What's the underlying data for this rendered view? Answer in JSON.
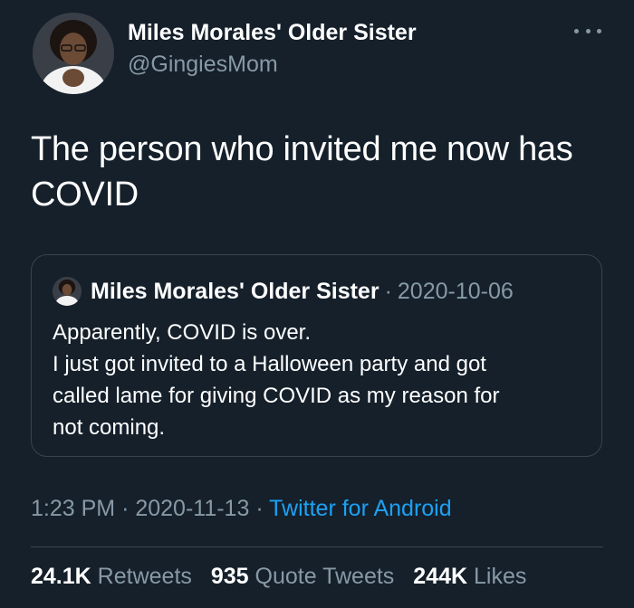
{
  "author": {
    "name": "Miles Morales' Older Sister",
    "handle": "@GingiesMom"
  },
  "tweet": {
    "text_line1": "The person who invited me now has",
    "text_line2": "COVID"
  },
  "quoted_tweet": {
    "name": "Miles Morales' Older Sister",
    "separator": "·",
    "date": "2020-10-06",
    "lines": [
      "Apparently, COVID is over.",
      "I just got invited to a Halloween party and got",
      "called lame for giving COVID as my reason for",
      "not coming."
    ]
  },
  "meta": {
    "time": "1:23 PM",
    "separator": "·",
    "date": "2020-11-13",
    "source": "Twitter for Android"
  },
  "stats": {
    "retweets_count": "24.1K",
    "retweets_label": "Retweets",
    "quotes_count": "935",
    "quotes_label": "Quote Tweets",
    "likes_count": "244K",
    "likes_label": "Likes"
  },
  "icons": {
    "more": "more-dots-icon"
  },
  "colors": {
    "background": "#15202b",
    "secondary_text": "#8899a6",
    "link": "#1da1f2",
    "border": "#38444d"
  }
}
